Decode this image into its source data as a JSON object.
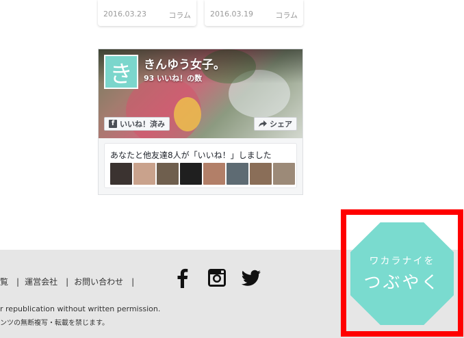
{
  "articles": [
    {
      "peek": "",
      "date": "2016.03.23",
      "category": "コラム"
    },
    {
      "peek": "......",
      "date": "2016.03.19",
      "category": "コラム"
    }
  ],
  "fb_widget": {
    "avatar_char": "き",
    "page_name": "きんゆう女子。",
    "likes_count": "93 いいね！の数",
    "like_button": "いいね！済み",
    "share_button": "シェア",
    "friends_text": "あなたと他友達8人が「いいね！」しました",
    "friend_avatars": [
      "#3b3330",
      "#c9a28c",
      "#6f5f4e",
      "#1f1f1f",
      "#b27f68",
      "#5e6b73",
      "#8a6e58",
      "#9c8a78"
    ]
  },
  "footer": {
    "links": [
      "覧",
      "運営会社",
      "お問い合わせ"
    ],
    "social": [
      "facebook-icon",
      "instagram-icon",
      "twitter-icon"
    ],
    "copyright_en": "r republication without written permission.",
    "copyright_jp": "ンツの無断複写・転載を禁じます。"
  },
  "tweet_button": {
    "line1": "ワカラナイを",
    "line2": "つぶやく",
    "color": "#7adbcf",
    "frame_color": "#ff0000"
  }
}
